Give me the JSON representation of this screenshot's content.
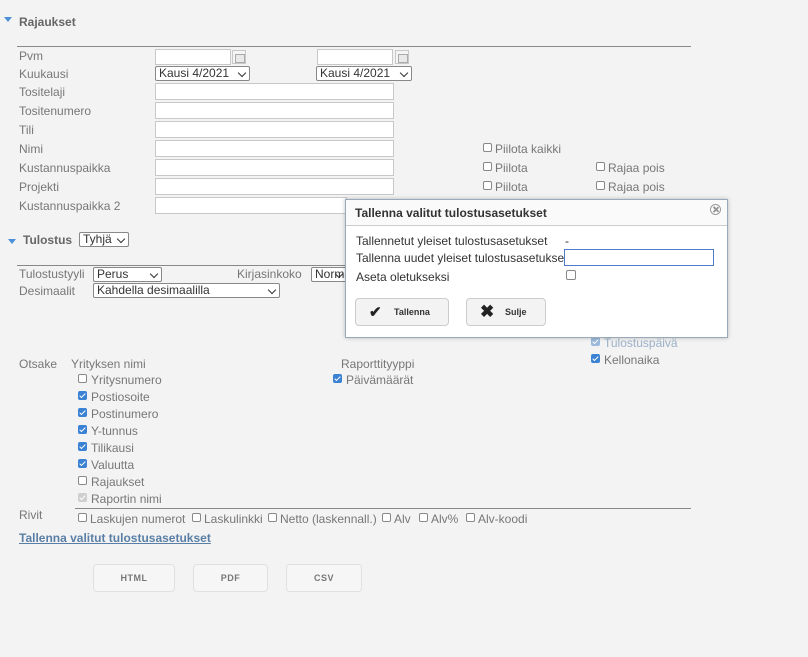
{
  "rajaukset": {
    "title": "Rajaukset",
    "labels": {
      "pvm": "Pvm",
      "kuukausi": "Kuukausi",
      "tositelaji": "Tositelaji",
      "tositenumero": "Tositenumero",
      "tili": "Tili",
      "nimi": "Nimi",
      "kustannuspaikka": "Kustannuspaikka",
      "projekti": "Projekti",
      "kustannuspaikka2": "Kustannuspaikka 2"
    },
    "month_start": "Kausi 4/2021",
    "month_end": "Kausi 4/2021",
    "piilota_kaikki": "Piilota kaikki",
    "piilota": "Piilota",
    "rajaa_pois": "Rajaa pois"
  },
  "tulostus": {
    "title": "Tulostus",
    "title_select": "Tyhjä",
    "tulostustyyli_label": "Tulostustyyli",
    "tulostustyyli_value": "Perus",
    "kirjasinkoko_label": "Kirjasinkoko",
    "kirjasinkoko_value": "Norma",
    "desimaalit_label": "Desimaalit",
    "desimaalit_value": "Kahdella desimaalilla",
    "otsake_label": "Otsake",
    "yrityksen_nimi": "Yrityksen nimi",
    "raporttityyppi": "Raporttityyppi",
    "paivamaarat": "Päivämäärät",
    "tulostuspaiva": "Tulostuspäivä",
    "kellonaika": "Kellonaika",
    "header_options": [
      {
        "label": "Yritysnumero",
        "state": "off"
      },
      {
        "label": "Postiosoite",
        "state": "on"
      },
      {
        "label": "Postinumero",
        "state": "on"
      },
      {
        "label": "Y-tunnus",
        "state": "on"
      },
      {
        "label": "Tilikausi",
        "state": "on"
      },
      {
        "label": "Valuutta",
        "state": "on"
      },
      {
        "label": "Rajaukset",
        "state": "off"
      },
      {
        "label": "Raportin nimi",
        "state": "disabled"
      }
    ],
    "rivit_label": "Rivit",
    "rivit_options": [
      "Laskujen numerot",
      "Laskulinkki",
      "Netto (laskennall.)",
      "Alv",
      "Alv%",
      "Alv-koodi"
    ],
    "save_link": "Tallenna valitut tulostusasetukset"
  },
  "export": {
    "html": "HTML",
    "pdf": "PDF",
    "csv": "CSV"
  },
  "dialog": {
    "title": "Tallenna valitut tulostusasetukset",
    "saved_label": "Tallennetut yleiset tulostusasetukset",
    "saved_value": "-",
    "new_label": "Tallenna uudet yleiset tulostusasetukset",
    "new_value": "",
    "default_label": "Aseta oletukseksi",
    "save_button": "Tallenna",
    "close_button": "Sulje"
  },
  "colors": {
    "accent": "#3b82d4",
    "link": "#5a7fa6"
  }
}
